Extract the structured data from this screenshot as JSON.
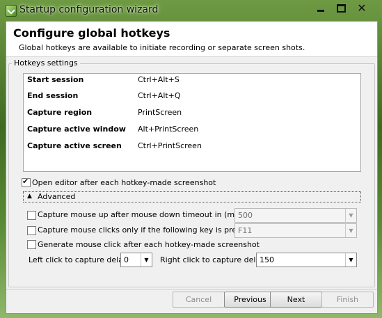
{
  "window": {
    "title": "Startup configuration wizard",
    "close_glyph": "✕"
  },
  "header": {
    "title": "Configure global hotkeys",
    "subtitle": "Global hotkeys are available to initiate recording or separate screen shots."
  },
  "hotkeys_group": {
    "title": "Hotkeys settings",
    "rows": [
      {
        "action": "Start session",
        "keys": "Ctrl+Alt+S"
      },
      {
        "action": "End session",
        "keys": "Ctrl+Alt+Q"
      },
      {
        "action": "Capture region",
        "keys": "PrintScreen"
      },
      {
        "action": "Capture active window",
        "keys": "Alt+PrintScreen"
      },
      {
        "action": "Capture active screen",
        "keys": "Ctrl+PrintScreen"
      }
    ],
    "open_editor": {
      "label": "Open editor after each hotkey-made screenshot",
      "checked": true
    },
    "advanced": {
      "label": "Advanced",
      "expanded": true,
      "mouse_up": {
        "label": "Capture mouse up after mouse down timeout in (millisec)",
        "checked": false,
        "value": "500"
      },
      "mouse_clicks_key": {
        "label": "Capture mouse clicks only if the following key is pressed:",
        "checked": false,
        "value": "F11"
      },
      "generate_click": {
        "label": "Generate mouse click after each hotkey-made screenshot",
        "checked": false
      },
      "left_delay": {
        "label": "Left click to capture delay",
        "value": "0"
      },
      "right_delay": {
        "label": "Right click to capture delay",
        "value": "150"
      }
    }
  },
  "footer": {
    "cancel": "Cancel",
    "previous": "Previous",
    "next": "Next",
    "finish": "Finish"
  },
  "icons": {
    "app": "app-icon",
    "minimize": "minimize-icon",
    "maximize": "maximize-icon",
    "close": "close-icon",
    "collapse": "chevron-up-icon",
    "dropdown": "chevron-down-icon"
  }
}
